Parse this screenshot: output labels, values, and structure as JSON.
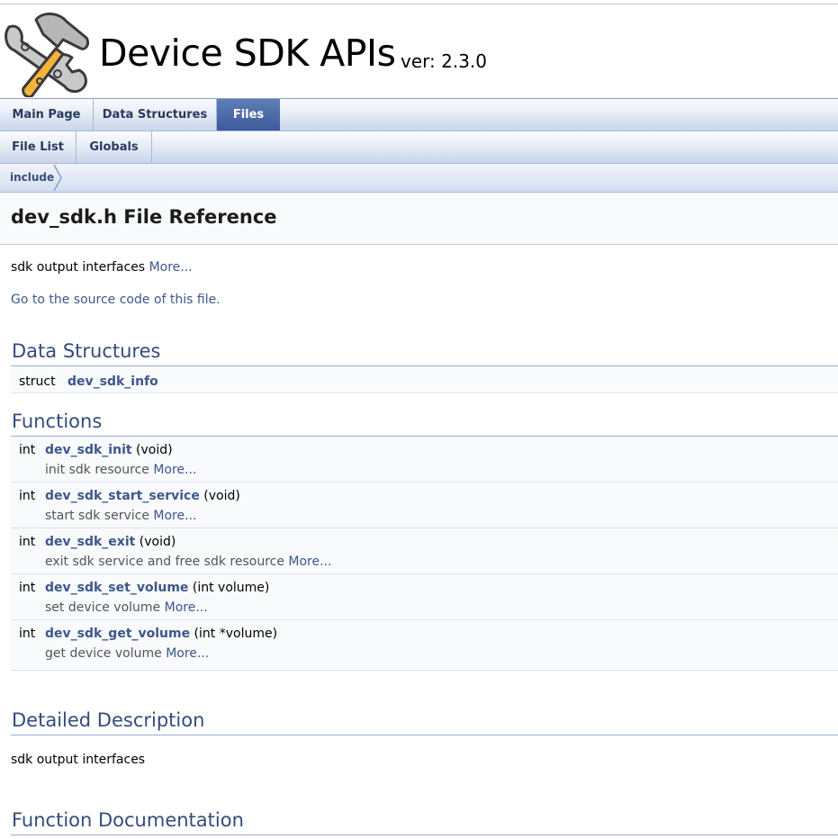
{
  "header": {
    "project_name": "Device SDK APIs",
    "version": "ver: 2.3.0",
    "logo_icon": "wrench-hammer-logo-icon"
  },
  "nav": {
    "main_tabs": [
      "Main Page",
      "Data Structures",
      "Files"
    ],
    "selected_main_tab": "Files",
    "sub_tabs": [
      "File List",
      "Globals"
    ],
    "breadcrumb": "include"
  },
  "page": {
    "title": "dev_sdk.h File Reference",
    "brief": "sdk output interfaces",
    "more": "More...",
    "source_link": "Go to the source code of this file."
  },
  "data_structures": {
    "heading": "Data Structures",
    "items": [
      {
        "type": "struct",
        "name": "dev_sdk_info"
      }
    ]
  },
  "functions": {
    "heading": "Functions",
    "items": [
      {
        "ret": "int",
        "name": "dev_sdk_init",
        "args": " (void)",
        "desc": "init sdk resource",
        "more": "More..."
      },
      {
        "ret": "int",
        "name": "dev_sdk_start_service",
        "args": " (void)",
        "desc": "start sdk service",
        "more": "More..."
      },
      {
        "ret": "int",
        "name": "dev_sdk_exit",
        "args": " (void)",
        "desc": "exit sdk service and free sdk resource",
        "more": "More..."
      },
      {
        "ret": "int",
        "name": "dev_sdk_set_volume",
        "args": " (int volume)",
        "desc": "set device volume",
        "more": "More..."
      },
      {
        "ret": "int",
        "name": "dev_sdk_get_volume",
        "args": " (int *volume)",
        "desc": "get device volume",
        "more": "More..."
      }
    ]
  },
  "detailed": {
    "heading": "Detailed Description",
    "text": "sdk output interfaces"
  },
  "function_doc": {
    "heading": "Function Documentation"
  },
  "colors": {
    "link": "#3d578c",
    "heading": "#354c7b",
    "selected_tab": "#3d5a99"
  }
}
